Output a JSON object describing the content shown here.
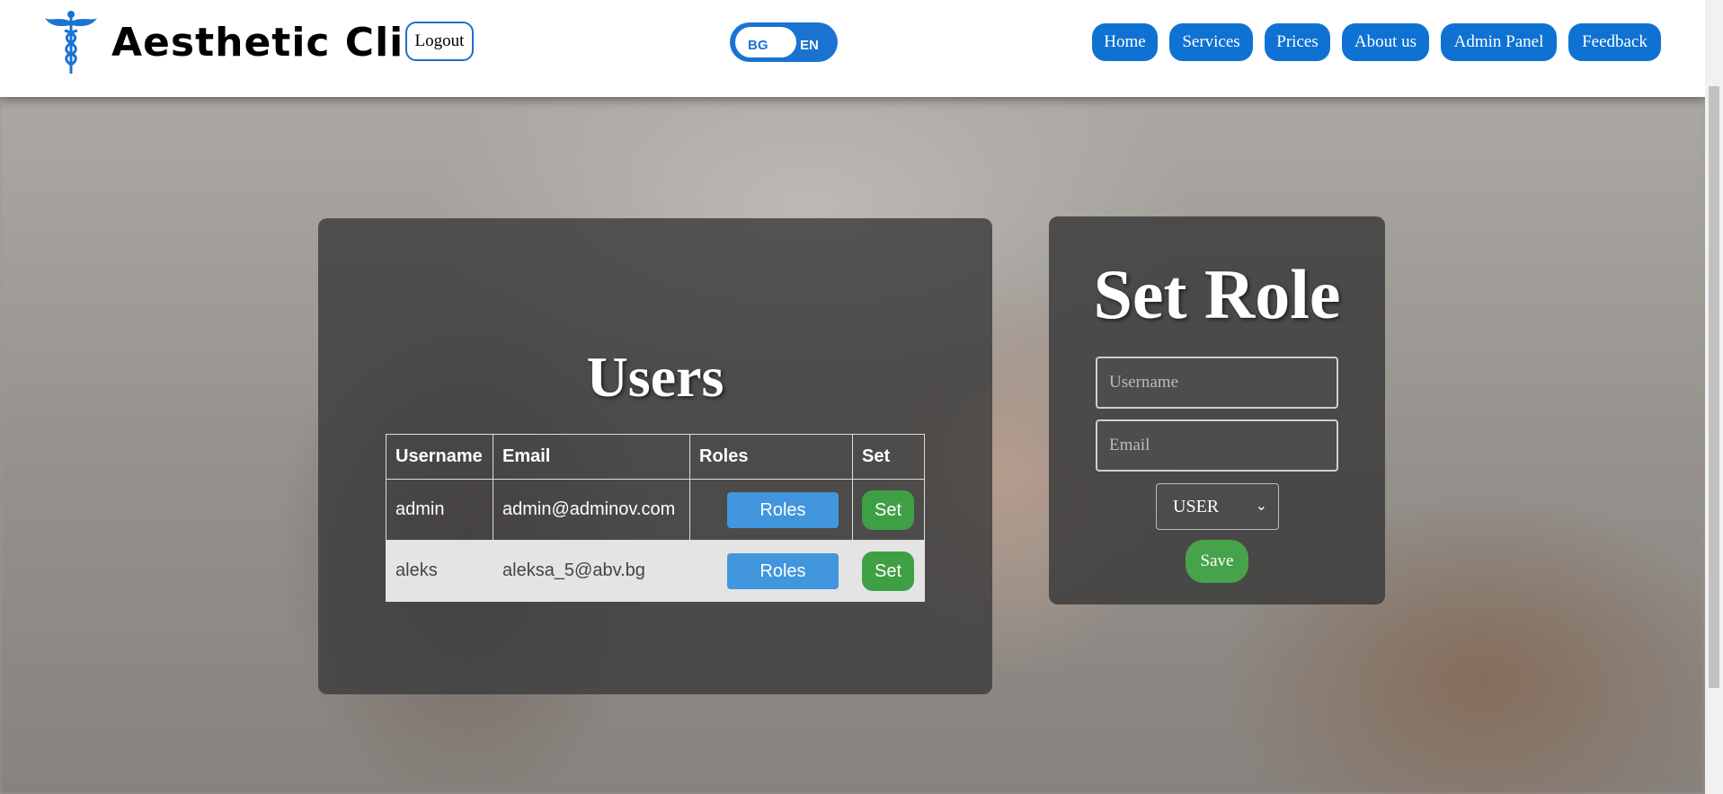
{
  "header": {
    "brand": "Aesthetic Clinic",
    "logout_label": "Logout",
    "lang_bg": "BG",
    "lang_en": "EN",
    "nav": [
      "Home",
      "Services",
      "Prices",
      "About us",
      "Admin Panel",
      "Feedback"
    ]
  },
  "users": {
    "title": "Users",
    "columns": [
      "Username",
      "Email",
      "Roles",
      "Set"
    ],
    "rows": [
      {
        "username": "admin",
        "email": "admin@adminov.com",
        "roles_label": "Roles",
        "set_label": "Set"
      },
      {
        "username": "aleks",
        "email": "aleksa_5@abv.bg",
        "roles_label": "Roles",
        "set_label": "Set"
      }
    ]
  },
  "set_role": {
    "title": "Set Role",
    "username_placeholder": "Username",
    "email_placeholder": "Email",
    "role_selected": "USER",
    "save_label": "Save"
  },
  "colors": {
    "primary": "#0f72d3",
    "success": "#3f9f45",
    "roles_button": "#4196de"
  },
  "icons": {
    "logo": "caduceus-icon",
    "select": "chevron-down-icon"
  }
}
